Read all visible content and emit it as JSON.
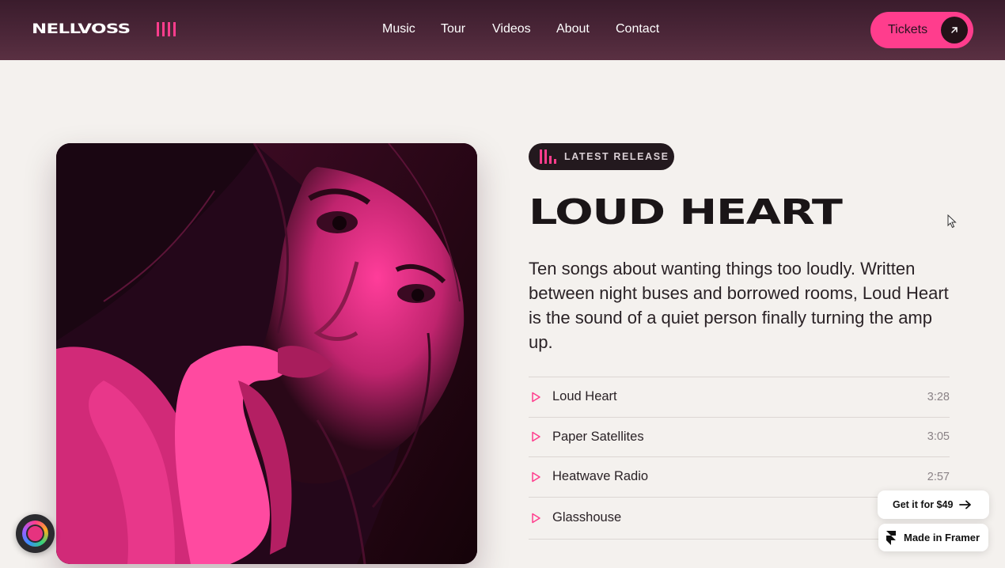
{
  "header": {
    "logo_text": "NELLVOSS",
    "nav": [
      "Music",
      "Tour",
      "Videos",
      "About",
      "Contact"
    ],
    "tickets_label": "Tickets"
  },
  "release": {
    "badge": "LATEST RELEASE",
    "title": "LOUD HEART",
    "description": "Ten songs about wanting things too loudly. Written between night buses and borrowed rooms, Loud Heart is the sound of a quiet person finally turning the amp up.",
    "tracks": [
      {
        "name": "Loud Heart",
        "duration": "3:28"
      },
      {
        "name": "Paper Satellites",
        "duration": "3:05"
      },
      {
        "name": "Heatwave Radio",
        "duration": "2:57"
      },
      {
        "name": "Glasshouse",
        "duration": ""
      }
    ]
  },
  "widgets": {
    "get_it_label": "Get it for $49",
    "made_in_label": "Made in Framer"
  },
  "colors": {
    "accent": "#ff3d8d",
    "header_bg": "#4b2638",
    "page_bg": "#f4f1ee",
    "dark": "#23191e"
  },
  "icons": {
    "tickets_arrow": "arrow-up-right-icon",
    "track_play": "play-outline-icon",
    "get_it_arrow": "arrow-right-icon",
    "framer_logo": "framer-logo-icon"
  }
}
